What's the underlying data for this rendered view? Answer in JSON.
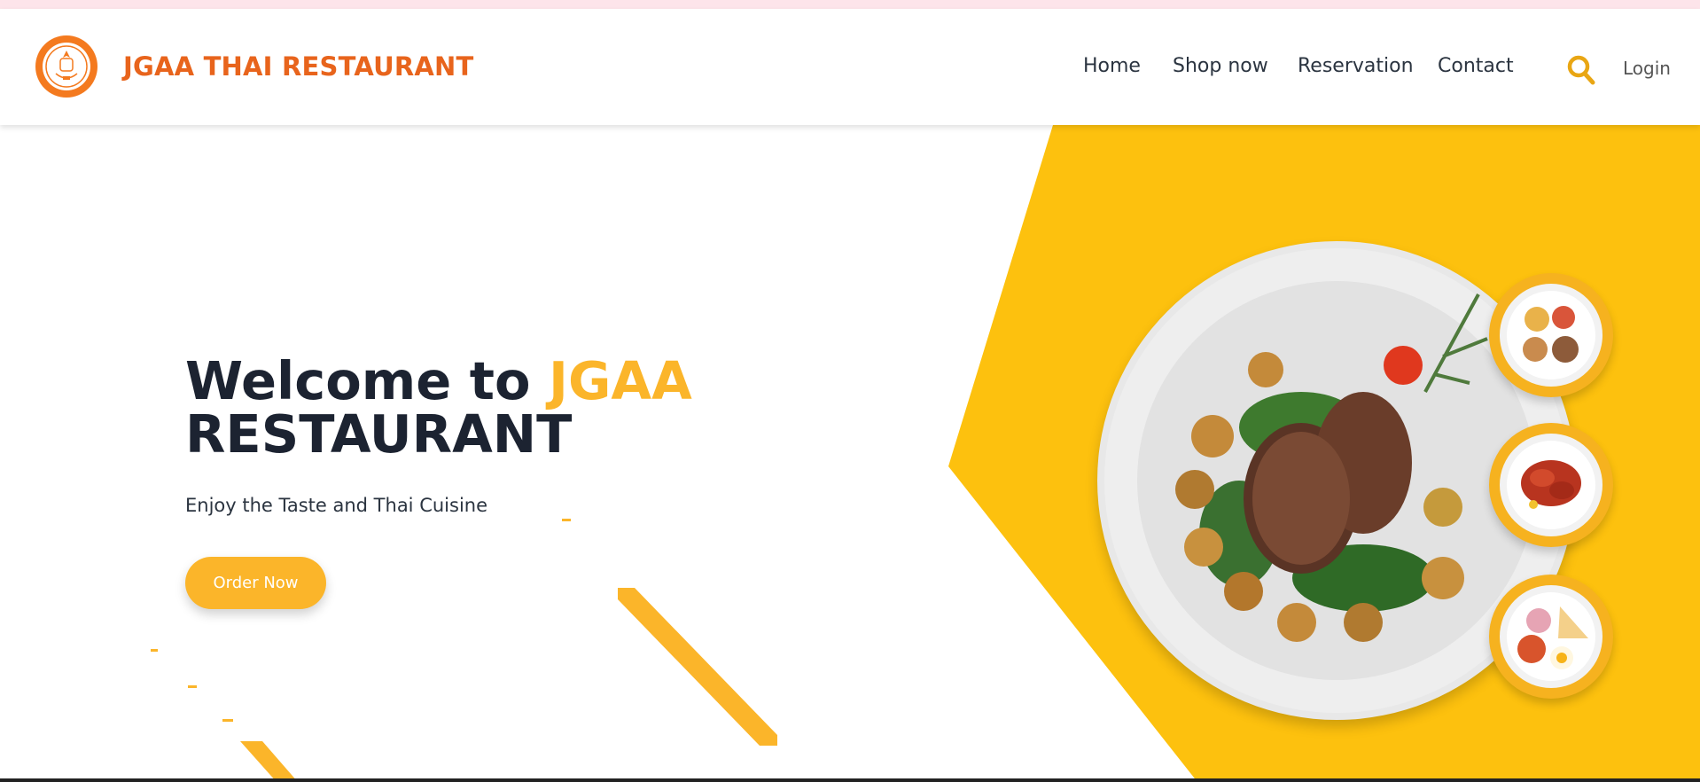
{
  "brand": {
    "name": "JGAA THAI RESTAURANT",
    "logo_icon": "restaurant-emblem-icon"
  },
  "nav": {
    "items": [
      {
        "label": "Home"
      },
      {
        "label": "Shop now"
      },
      {
        "label": "Reservation"
      },
      {
        "label": "Contact"
      }
    ],
    "search_icon": "search-icon",
    "login_label": "Login"
  },
  "hero": {
    "title_prefix": "Welcome to",
    "title_accent": "JGAA",
    "title_line2": "RESTAURANT",
    "subtitle": "Enjoy the Taste and Thai Cuisine",
    "cta_label": "Order Now"
  },
  "colors": {
    "accent_yellow": "#fdc10e",
    "brand_orange": "#e8641c",
    "button_yellow": "#fbb52a",
    "text_dark": "#1c2331"
  },
  "images": {
    "main_dish": "steak-plate-image",
    "thumbnails": [
      "thai-platter-thumbnail",
      "fried-chicken-thumbnail",
      "breakfast-plate-thumbnail"
    ]
  }
}
